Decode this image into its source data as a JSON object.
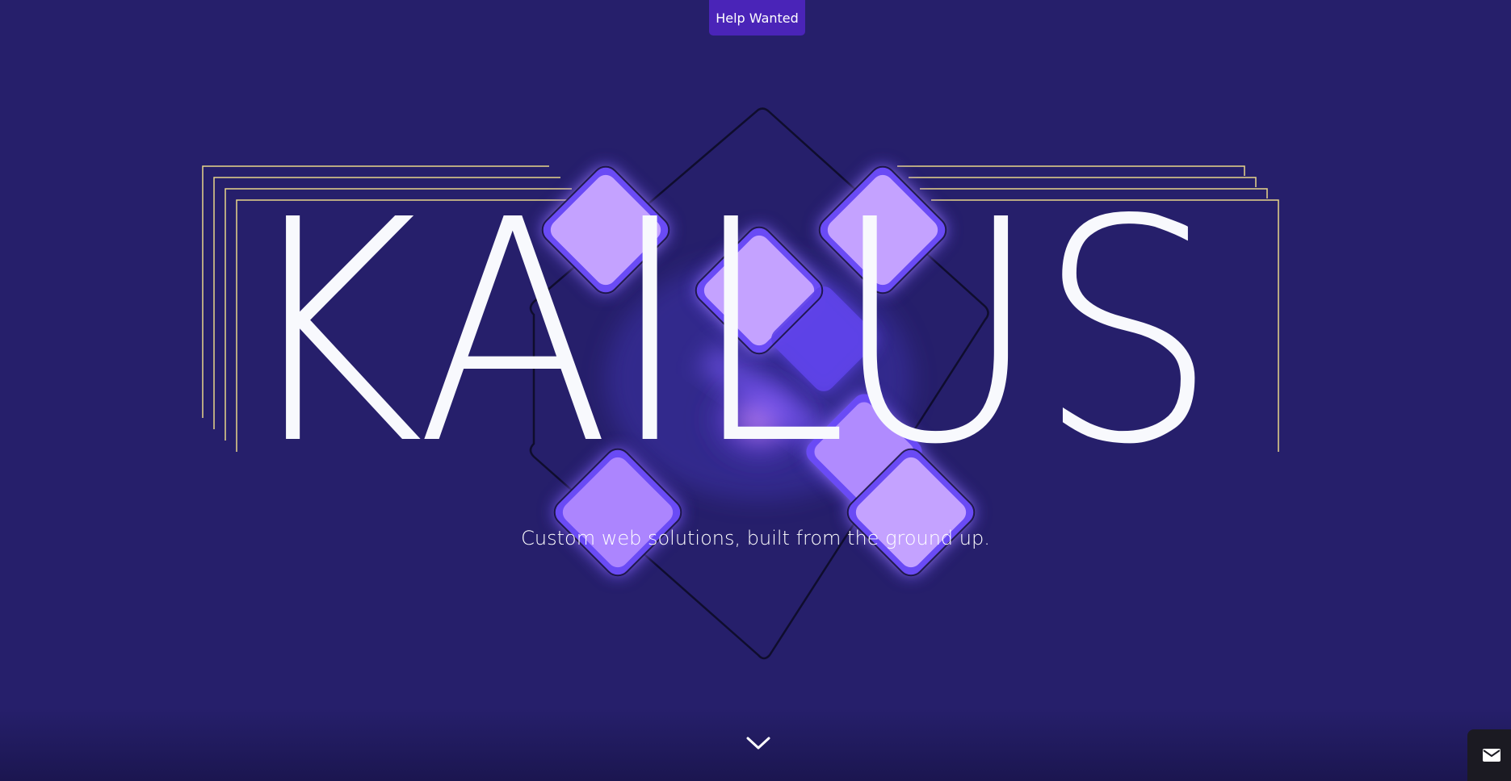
{
  "header": {
    "help_tab_label": "Help Wanted"
  },
  "hero": {
    "brand": "KAILUS",
    "tagline": "Custom web solutions, built from the ground up."
  },
  "icons": {
    "scroll": "chevron-down-icon",
    "contact": "mail-icon"
  },
  "colors": {
    "background": "#261f6b",
    "accent_button": "#4a24b8",
    "frame_lines": "#e8d58a",
    "cube_glow": "#7a55ff",
    "cube_face": "#c7a2ff",
    "text": "#f8f9fd"
  }
}
